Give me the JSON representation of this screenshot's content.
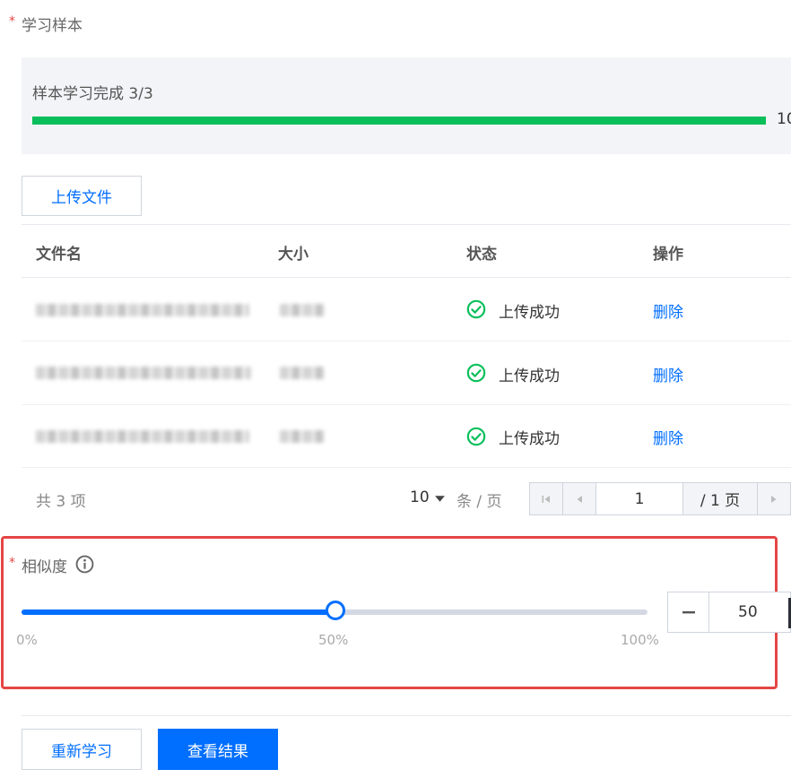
{
  "sample": {
    "required_mark": "*",
    "label": "学习样本",
    "progress_title": "样本学习完成 3/3",
    "progress_value": 1.0,
    "progress_text": "10",
    "upload_button": "上传文件"
  },
  "table": {
    "columns": [
      "文件名",
      "大小",
      "状态",
      "操作"
    ],
    "rows": [
      {
        "status": "上传成功",
        "action": "删除"
      },
      {
        "status": "上传成功",
        "action": "删除"
      },
      {
        "status": "上传成功",
        "action": "删除"
      }
    ],
    "total": "共 3 项",
    "page_size": "10",
    "page_size_unit": "条 / 页",
    "current_page": "1",
    "total_pages": "/ 1 页"
  },
  "similarity": {
    "required_mark": "*",
    "label": "相似度",
    "value": 50,
    "value_text": "50",
    "min_label": "0%",
    "mid_label": "50%",
    "max_label": "100%"
  },
  "actions": {
    "relearn": "重新学习",
    "view_results": "查看结果"
  },
  "colors": {
    "accent": "#006eff",
    "success": "#0abf5b",
    "danger": "#e54545"
  }
}
